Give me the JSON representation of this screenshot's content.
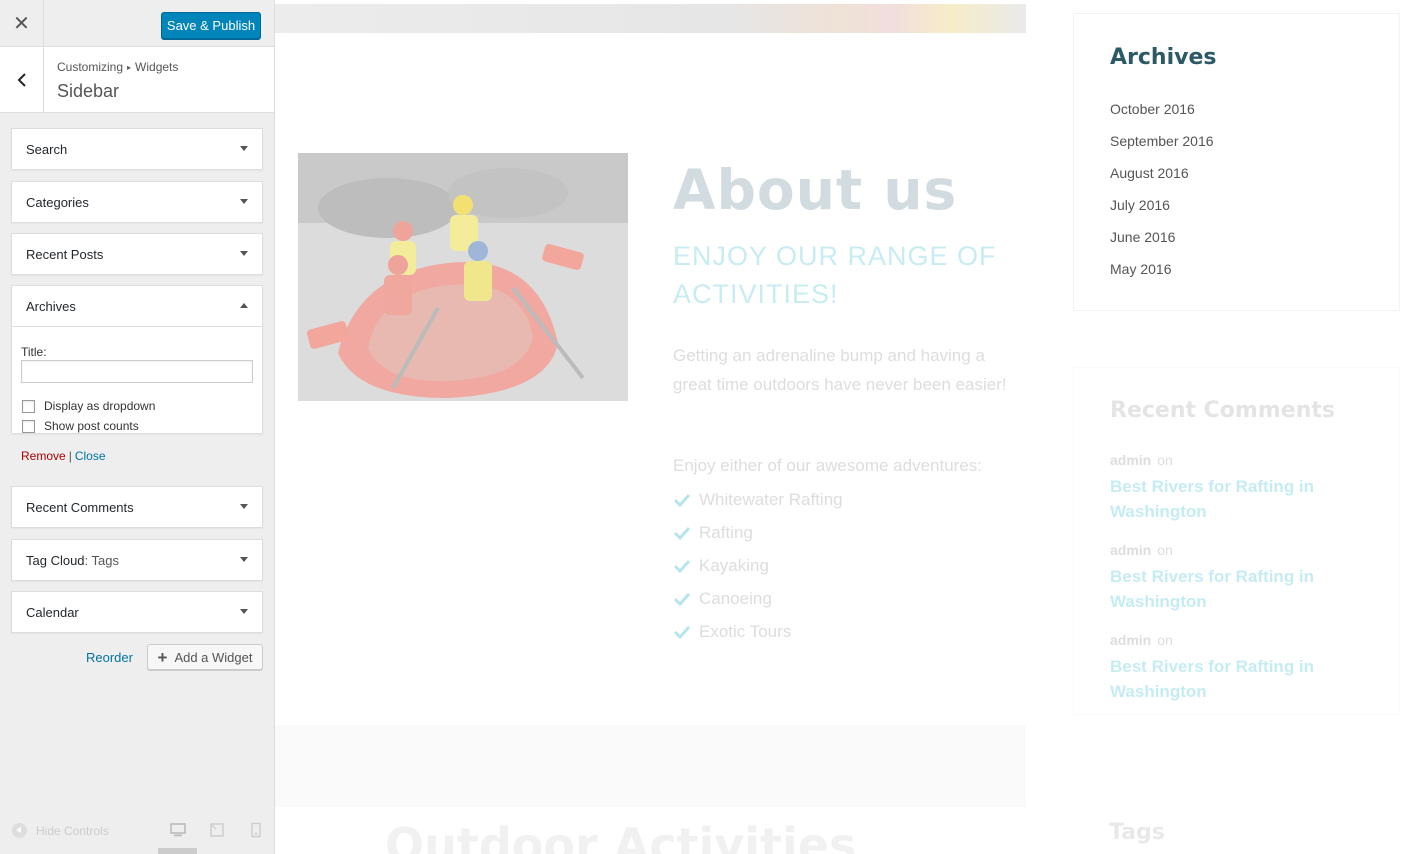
{
  "topbar": {
    "close_icon": "close-icon",
    "publish_label": "Save & Publish"
  },
  "section": {
    "breadcrumb_root": "Customizing",
    "breadcrumb_child": "Widgets",
    "title": "Sidebar"
  },
  "widgets": [
    {
      "title": "Search",
      "sub": "",
      "expanded": false
    },
    {
      "title": "Categories",
      "sub": "",
      "expanded": false
    },
    {
      "title": "Recent Posts",
      "sub": "",
      "expanded": false
    },
    {
      "title": "Archives",
      "sub": "",
      "expanded": true
    },
    {
      "title": "Recent Comments",
      "sub": "",
      "expanded": false
    },
    {
      "title": "Tag Cloud",
      "sub": ": Tags",
      "expanded": false
    },
    {
      "title": "Calendar",
      "sub": "",
      "expanded": false
    }
  ],
  "archives_form": {
    "title_label": "Title:",
    "title_value": "",
    "dropdown_label": "Display as dropdown",
    "dropdown_checked": false,
    "counts_label": "Show post counts",
    "counts_checked": false,
    "remove_label": "Remove",
    "separator": "|",
    "close_label": "Close"
  },
  "panel_actions": {
    "reorder_label": "Reorder",
    "add_widget_label": "Add a Widget"
  },
  "footer": {
    "hide_controls_label": "Hide Controls",
    "devices": [
      "desktop-icon",
      "tablet-icon",
      "mobile-icon"
    ]
  },
  "preview": {
    "about_title": "About us",
    "about_subtitle": "ENJOY OUR RANGE OF ACTIVITIES!",
    "about_body": "Getting an adrenaline bump and having a great time outdoors have never been easier!",
    "activities_lead": "Enjoy either of our awesome adventures:",
    "activities": [
      "Whitewater Rafting",
      "Rafting",
      "Kayaking",
      "Canoeing",
      "Exotic Tours"
    ],
    "next_section_title": "Outdoor Activities",
    "archives_heading": "Archives",
    "archives": [
      "October 2016",
      "September 2016",
      "August 2016",
      "July 2016",
      "June 2016",
      "May 2016"
    ],
    "comments_heading": "Recent Comments",
    "comments": [
      {
        "author": "admin",
        "on": "on",
        "post": "Best Rivers for Rafting in Washington"
      },
      {
        "author": "admin",
        "on": "on",
        "post": "Best Rivers for Rafting in Washington"
      },
      {
        "author": "admin",
        "on": "on",
        "post": "Best Rivers for Rafting in Washington"
      }
    ],
    "tags_heading": "Tags"
  },
  "colors": {
    "publish": "#0085ba",
    "archives_heading": "#2b5a66",
    "link": "#0073aa",
    "remove": "#aa0000"
  }
}
